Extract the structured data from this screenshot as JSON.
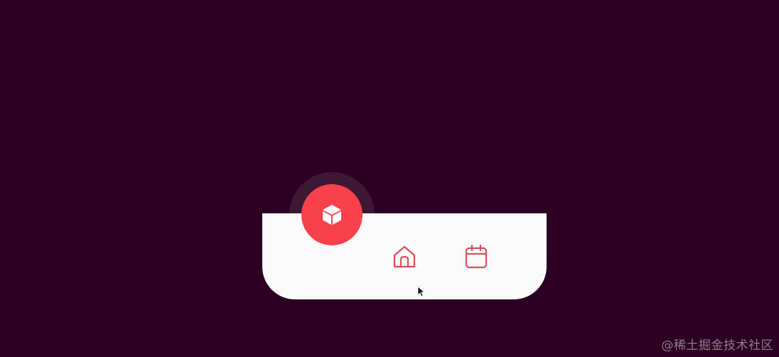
{
  "colors": {
    "background": "#2b0022",
    "bar": "#fbfbfb",
    "accent": "#f8414a",
    "icon": "#d9505a",
    "halo": "#3d1733"
  },
  "nav": {
    "items": [
      {
        "icon": "cube-icon",
        "active": true
      },
      {
        "icon": "home-icon",
        "active": false
      },
      {
        "icon": "calendar-icon",
        "active": false
      }
    ]
  },
  "watermark": {
    "text": "@稀土掘金技术社区"
  }
}
